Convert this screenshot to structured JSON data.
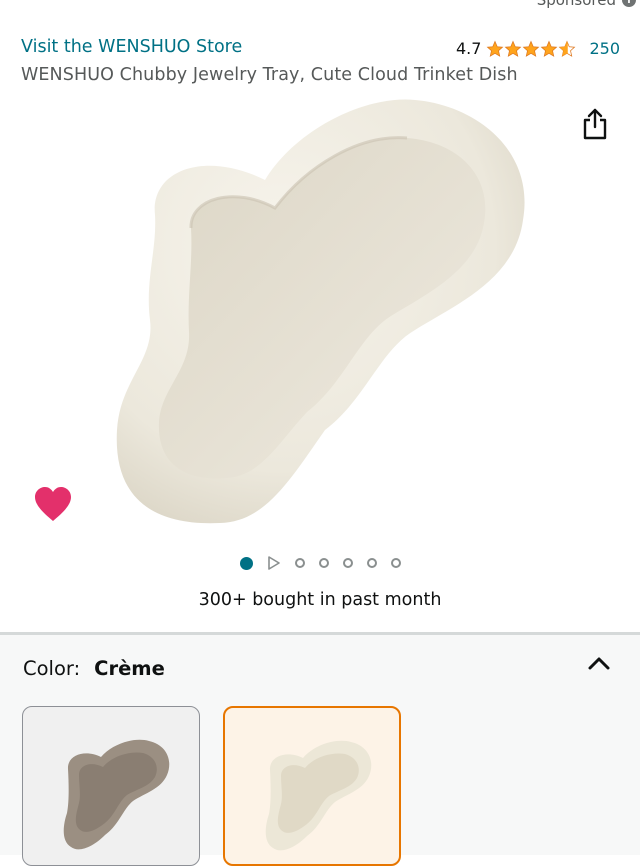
{
  "header": {
    "sponsored_label": "Sponsored",
    "store_link": "Visit the WENSHUO Store",
    "rating_value": "4.7",
    "rating_stars": 4.7,
    "review_count": "250"
  },
  "product": {
    "title": "WENSHUO Chubby Jewelry Tray, Cute Cloud Trinket Dish",
    "bought_text": "300+ bought in past month"
  },
  "gallery": {
    "dot_count": 7,
    "active_index": 0,
    "video_indicator_index": 1
  },
  "variant": {
    "color_label": "Color:",
    "color_value": "Crème",
    "swatches": [
      "taupe-swatch",
      "creme-swatch"
    ],
    "selected_swatch": 1
  },
  "colors": {
    "link": "#007185",
    "star": "#ffa41c",
    "heart": "#e3306b",
    "selected_border": "#e77600"
  },
  "icons": {
    "share": "share-icon",
    "heart": "heart-icon",
    "chevron": "chevron-up-icon"
  }
}
